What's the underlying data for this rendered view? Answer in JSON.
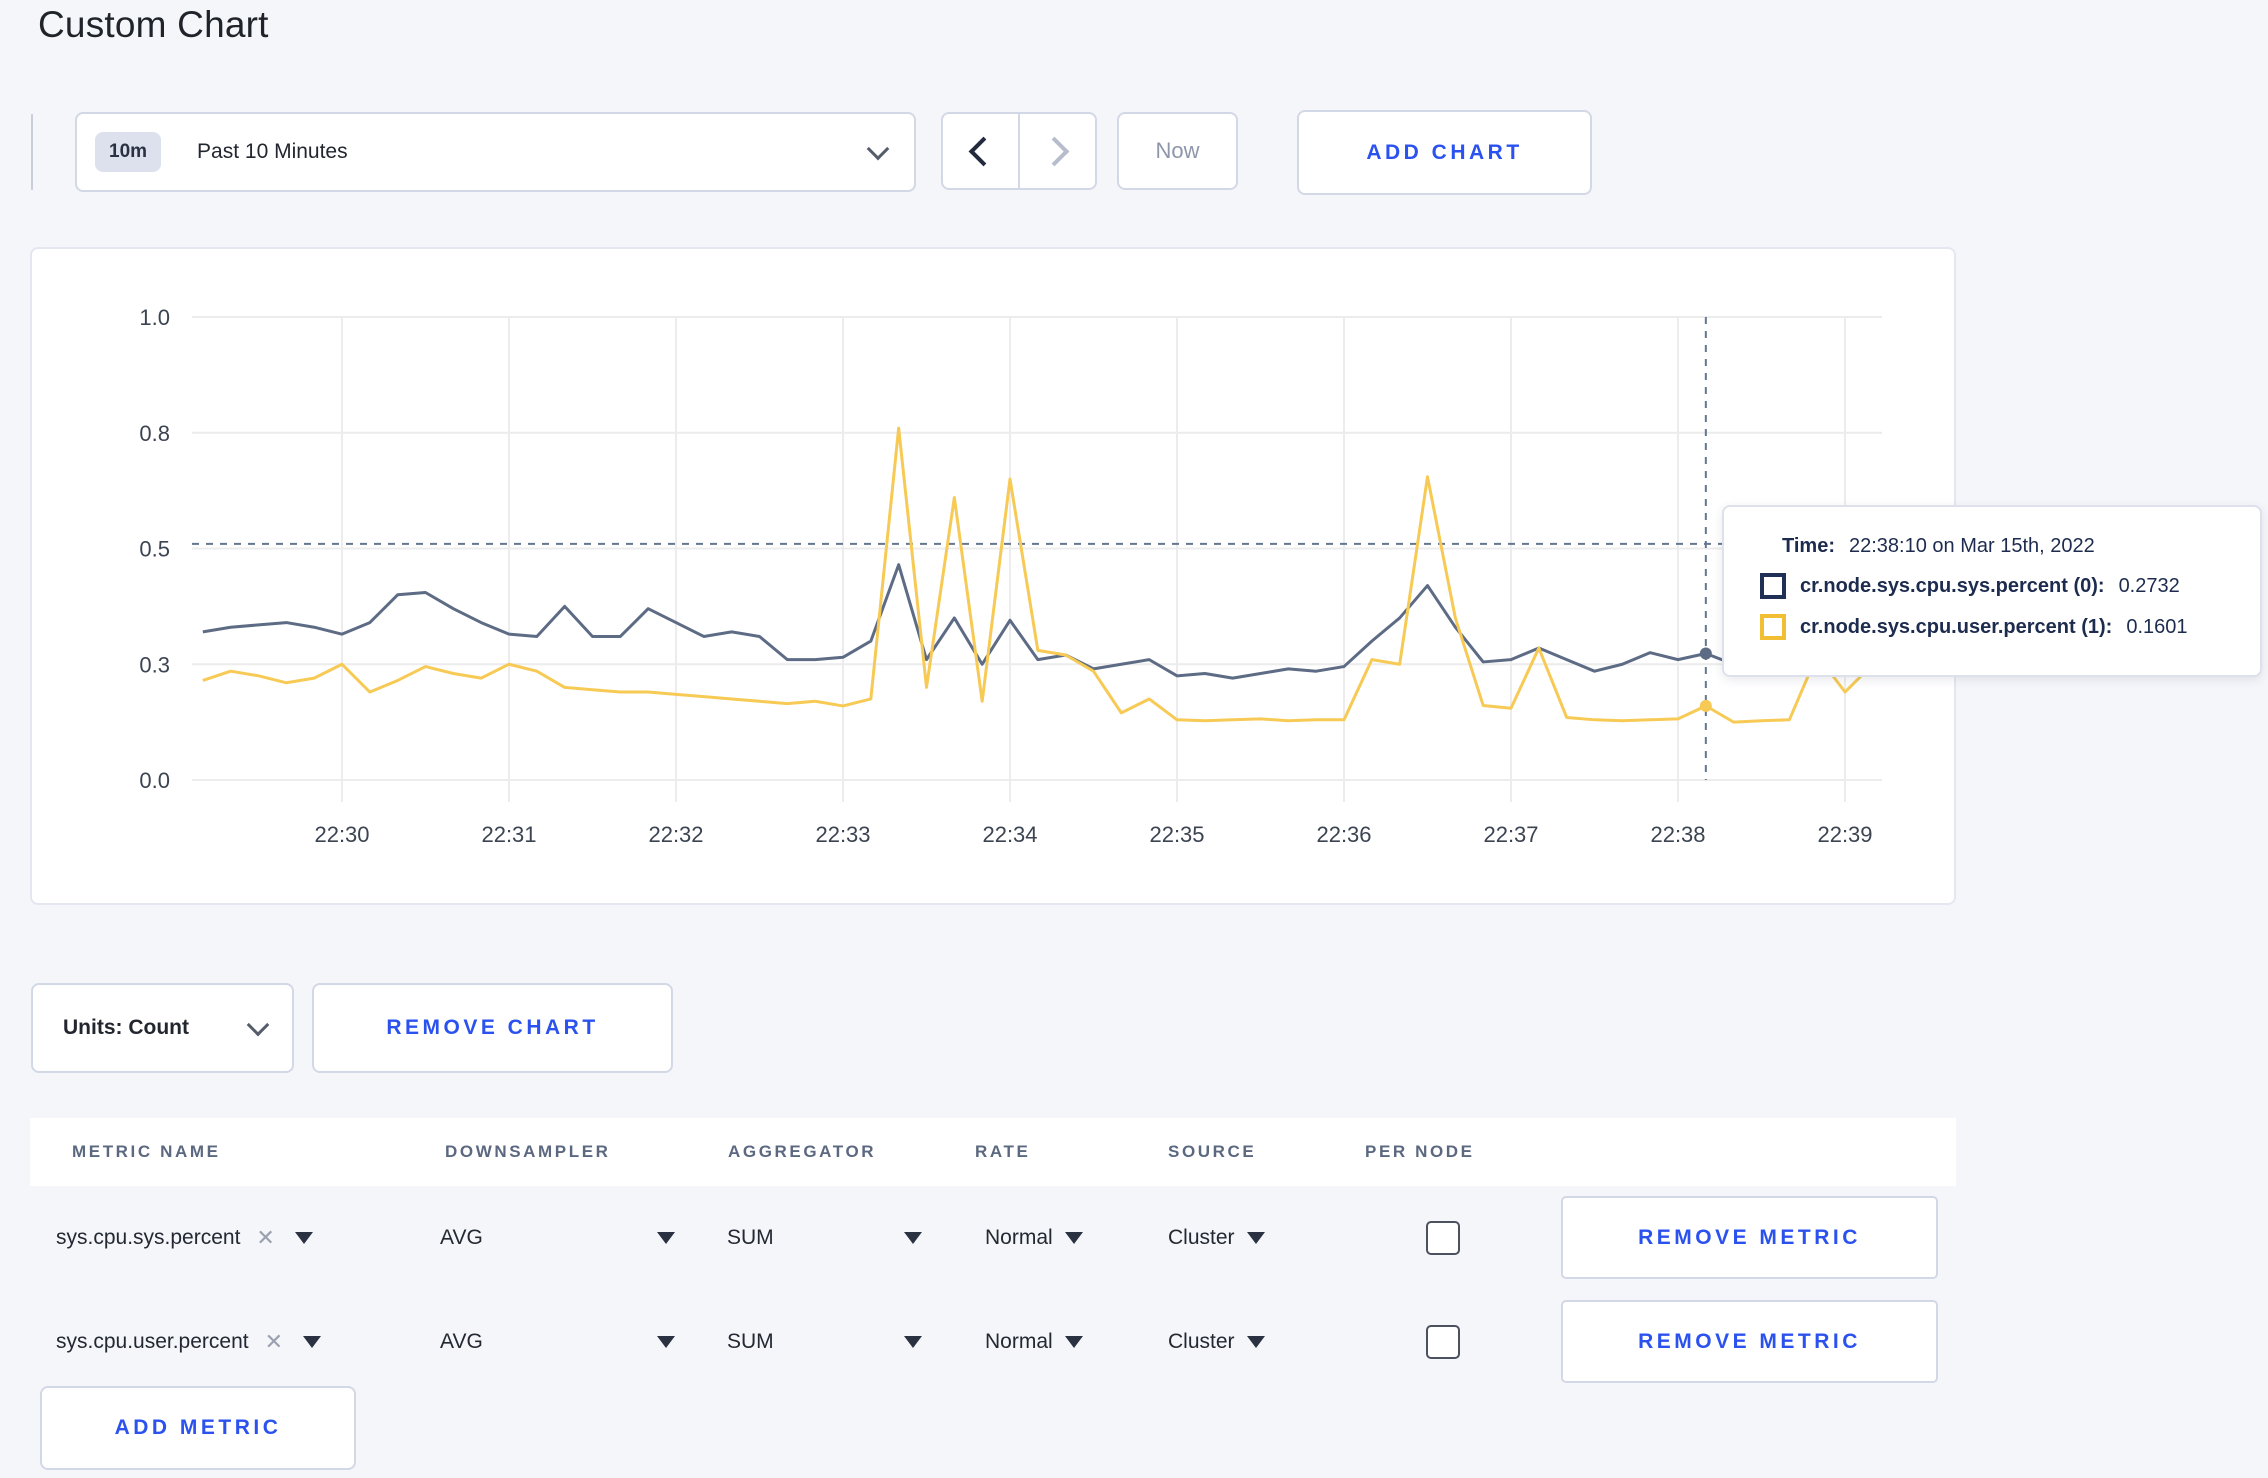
{
  "page": {
    "title": "Custom Chart"
  },
  "toolbar": {
    "timescale_badge": "10m",
    "timescale_label": "Past 10 Minutes",
    "now_label": "Now",
    "add_chart_label": "ADD CHART"
  },
  "chart": {
    "tooltip": {
      "time_label": "Time:",
      "time_value": "22:38:10 on Mar 15th, 2022",
      "series": [
        {
          "label": "cr.node.sys.cpu.sys.percent (0):",
          "value": "0.2732",
          "color": "#1f2f55"
        },
        {
          "label": "cr.node.sys.cpu.user.percent (1):",
          "value": "0.1601",
          "color": "#f2be33"
        }
      ]
    }
  },
  "chart_data": {
    "type": "line",
    "title": "",
    "xlabel": "",
    "ylabel": "",
    "ylim": [
      0,
      1
    ],
    "grid": true,
    "x_tick_labels": [
      "22:30",
      "22:31",
      "22:32",
      "22:33",
      "22:34",
      "22:35",
      "22:36",
      "22:37",
      "22:38",
      "22:39"
    ],
    "y_tick_values": [
      0,
      0.25,
      0.5,
      0.75,
      1.0
    ],
    "y_tick_labels": [
      "0.0",
      "0.3",
      "0.5",
      "0.8",
      "1.0"
    ],
    "x_start": "22:29:10",
    "x_step_seconds": 10,
    "threshold_line": 0.51,
    "hover": {
      "index": 54,
      "time": "22:38:10",
      "values": [
        0.2732,
        0.1601
      ]
    },
    "colors": {
      "crosshair": "#64778f",
      "gridline": "#ececec",
      "tick_text": "#3c4452"
    },
    "series": [
      {
        "name": "cr.node.sys.cpu.sys.percent",
        "color": "#5d6b85",
        "values": [
          0.32,
          0.33,
          0.335,
          0.34,
          0.33,
          0.315,
          0.34,
          0.4,
          0.405,
          0.37,
          0.34,
          0.315,
          0.31,
          0.375,
          0.31,
          0.31,
          0.37,
          0.34,
          0.31,
          0.32,
          0.31,
          0.26,
          0.26,
          0.265,
          0.3,
          0.465,
          0.26,
          0.35,
          0.25,
          0.345,
          0.26,
          0.27,
          0.24,
          0.25,
          0.26,
          0.225,
          0.23,
          0.22,
          0.23,
          0.24,
          0.235,
          0.245,
          0.3,
          0.35,
          0.42,
          0.33,
          0.255,
          0.26,
          0.285,
          0.26,
          0.235,
          0.25,
          0.275,
          0.26,
          0.2732,
          0.25,
          0.26,
          0.28,
          0.3,
          0.3,
          0.295
        ]
      },
      {
        "name": "cr.node.sys.cpu.user.percent",
        "color": "#f7ca55",
        "values": [
          0.215,
          0.235,
          0.225,
          0.21,
          0.22,
          0.25,
          0.19,
          0.215,
          0.245,
          0.23,
          0.22,
          0.25,
          0.235,
          0.2,
          0.195,
          0.19,
          0.19,
          0.185,
          0.18,
          0.175,
          0.17,
          0.165,
          0.17,
          0.16,
          0.175,
          0.76,
          0.2,
          0.61,
          0.17,
          0.65,
          0.28,
          0.27,
          0.235,
          0.145,
          0.175,
          0.13,
          0.128,
          0.13,
          0.132,
          0.128,
          0.13,
          0.13,
          0.26,
          0.25,
          0.655,
          0.35,
          0.161,
          0.155,
          0.285,
          0.135,
          0.13,
          0.128,
          0.13,
          0.132,
          0.1601,
          0.125,
          0.128,
          0.13,
          0.27,
          0.19,
          0.25
        ]
      }
    ]
  },
  "units": {
    "label": "Units: Count"
  },
  "chart_actions": {
    "remove_chart_label": "REMOVE CHART"
  },
  "table": {
    "headers": [
      "METRIC NAME",
      "DOWNSAMPLER",
      "AGGREGATOR",
      "RATE",
      "SOURCE",
      "PER NODE"
    ],
    "rows": [
      {
        "metric": "sys.cpu.sys.percent",
        "downsampler": "AVG",
        "aggregator": "SUM",
        "rate": "Normal",
        "source": "Cluster",
        "remove_label": "REMOVE METRIC"
      },
      {
        "metric": "sys.cpu.user.percent",
        "downsampler": "AVG",
        "aggregator": "SUM",
        "rate": "Normal",
        "source": "Cluster",
        "remove_label": "REMOVE METRIC"
      }
    ],
    "add_metric_label": "ADD METRIC"
  }
}
